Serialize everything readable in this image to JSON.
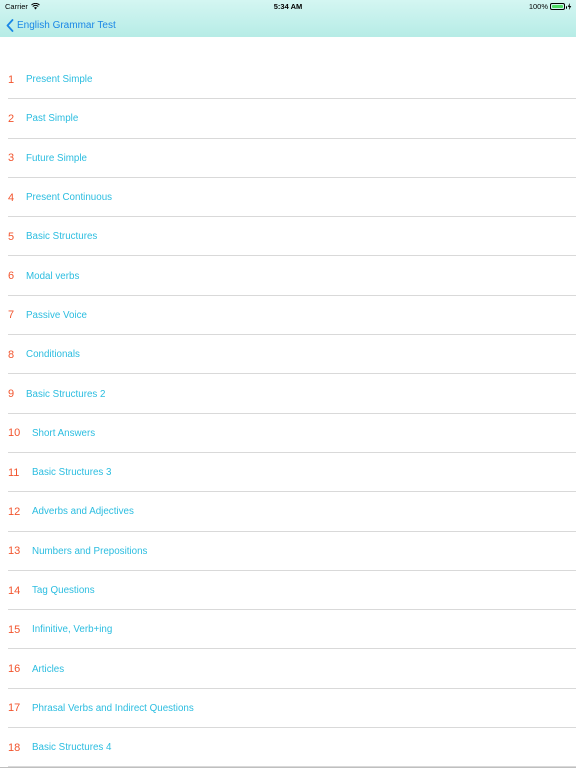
{
  "status_bar": {
    "carrier": "Carrier",
    "time": "5:34 AM",
    "battery": "100%",
    "wifi_icon": "wifi-icon",
    "battery_icon": "battery-icon",
    "charging_icon": "charging-icon"
  },
  "nav": {
    "back_label": "English Grammar Test",
    "back_icon": "chevron-left-icon"
  },
  "colors": {
    "number": "#f2542d",
    "title": "#2bbde0",
    "nav_link": "#1a87e6",
    "header_bg": "#c6f1ec"
  },
  "items": [
    {
      "number": "1",
      "title": "Present Simple"
    },
    {
      "number": "2",
      "title": "Past Simple"
    },
    {
      "number": "3",
      "title": "Future Simple"
    },
    {
      "number": "4",
      "title": "Present Continuous"
    },
    {
      "number": "5",
      "title": "Basic Structures"
    },
    {
      "number": "6",
      "title": "Modal verbs"
    },
    {
      "number": "7",
      "title": "Passive Voice"
    },
    {
      "number": "8",
      "title": "Conditionals"
    },
    {
      "number": "9",
      "title": "Basic Structures 2"
    },
    {
      "number": "10",
      "title": "Short Answers"
    },
    {
      "number": "11",
      "title": "Basic Structures 3"
    },
    {
      "number": "12",
      "title": "Adverbs and Adjectives"
    },
    {
      "number": "13",
      "title": "Numbers and Prepositions"
    },
    {
      "number": "14",
      "title": "Tag Questions"
    },
    {
      "number": "15",
      "title": "Infinitive, Verb+ing"
    },
    {
      "number": "16",
      "title": "Articles"
    },
    {
      "number": "17",
      "title": "Phrasal Verbs and Indirect Questions"
    },
    {
      "number": "18",
      "title": "Basic Structures 4"
    }
  ]
}
